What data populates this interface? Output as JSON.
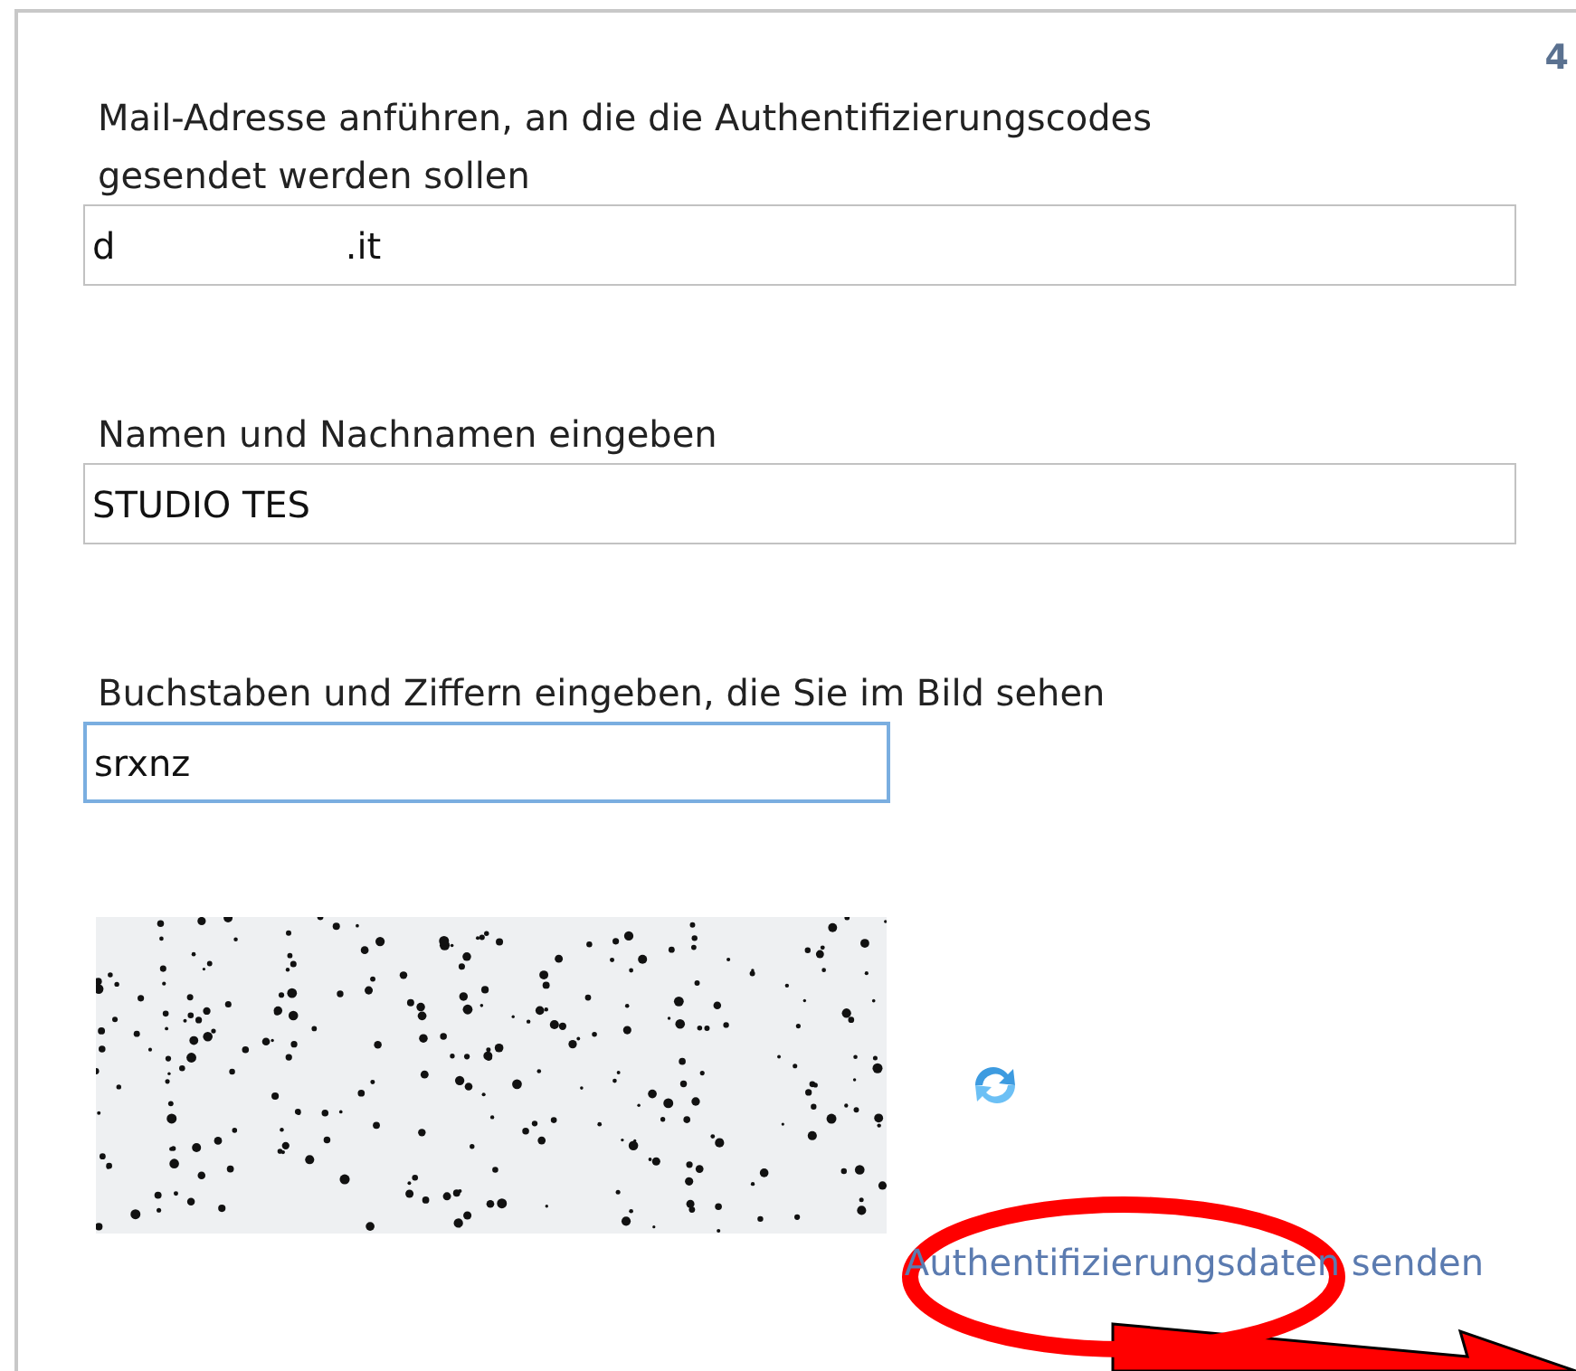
{
  "page_number": "4",
  "fields": [
    {
      "label": "Mail-Adresse anführen, an die die Authentifizierungscodes gesendet werden sollen",
      "value": "d                    .it",
      "focused": false
    },
    {
      "label": "Namen und Nachnamen eingeben",
      "value": "STUDIO TES",
      "focused": false
    },
    {
      "label": "Buchstaben und Ziffern eingeben, die Sie im Bild sehen",
      "value": "srxnz",
      "focused": true
    }
  ],
  "send_link": "Authentifizierungsdaten senden"
}
